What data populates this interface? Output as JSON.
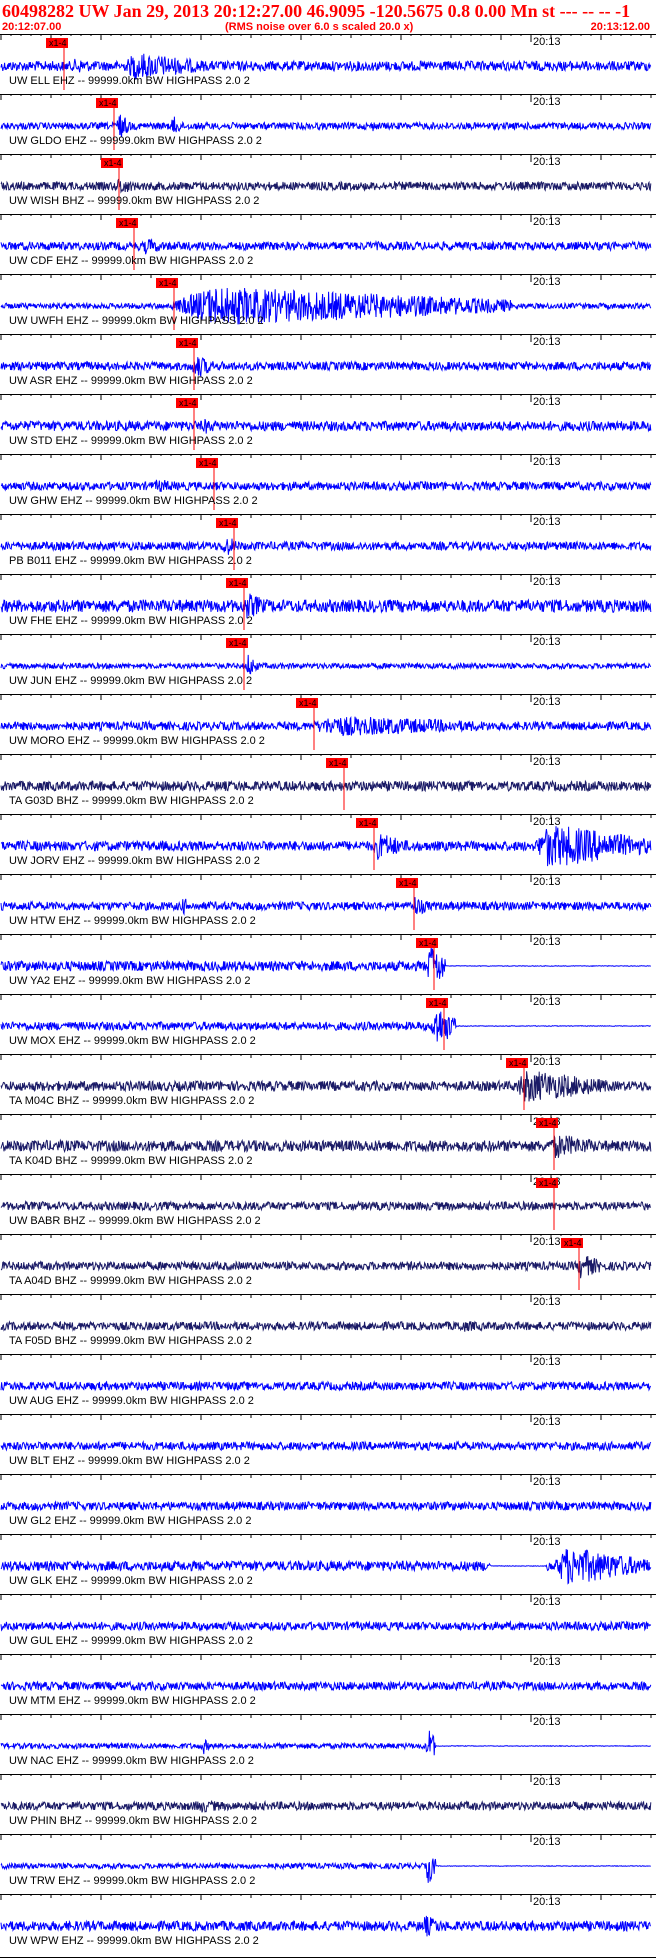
{
  "header": {
    "title": "60498282 UW Jan 29, 2013 20:12:27.00   46.9095 -120.5675  0.8 0.00 Mn st --- -- --   -1",
    "start_time": "20:12:07.00",
    "note": "(RMS noise over 6.0 s scaled 20.0 x)",
    "end_time": "20:13:12.00"
  },
  "colors": {
    "header_text": "#ff0000",
    "trace_blue": "#0000ff",
    "trace_navy": "#1a1a66",
    "pick": "#ff0000",
    "axis": "#000000"
  },
  "chart_data": {
    "type": "line",
    "title": "60498282 UW Jan 29, 2013 20:12:27.00   46.9095 -120.5675  0.8 0.00 Mn st --- -- --   -1",
    "subtitle": "(RMS noise over 6.0 s scaled 20.0 x)",
    "x_start": "20:12:07.00",
    "x_end": "20:13:12.00",
    "minute_label": "20:13",
    "minute_mark_s": 53,
    "xlim_s": [
      0,
      65
    ],
    "traces": [
      {
        "label": "UW ELL EHZ -- 99999.0km BW  HIGHPASS  2.0  2",
        "color": "#0000ff",
        "pick_label": "x1-4",
        "pick_s": 4.5,
        "amp": 0.35,
        "events": [
          {
            "t": 12,
            "dur": 9,
            "amp": 1.0
          },
          {
            "t": 7,
            "dur": 3,
            "amp": 0.6
          }
        ]
      },
      {
        "label": "UW GLDO EHZ -- 99999.0km BW  HIGHPASS  2.0  2",
        "color": "#0000ff",
        "pick_label": "x1-4",
        "pick_s": 9.5,
        "amp": 0.25,
        "events": [
          {
            "t": 11.5,
            "dur": 1.5,
            "amp": 1.0
          },
          {
            "t": 17,
            "dur": 1.2,
            "amp": 0.8
          },
          {
            "t": 37,
            "dur": 1,
            "amp": 0.4
          },
          {
            "t": 53,
            "dur": 1,
            "amp": 0.5
          }
        ]
      },
      {
        "label": "UW WISH BHZ -- 99999.0km BW  HIGHPASS  2.0  2",
        "color": "#1a1a66",
        "pick_label": "x1-4",
        "pick_s": 10,
        "amp": 0.3,
        "events": [
          {
            "t": 11.5,
            "dur": 2,
            "amp": 0.7
          }
        ]
      },
      {
        "label": "UW CDF EHZ -- 99999.0km BW  HIGHPASS  2.0  2",
        "color": "#0000ff",
        "pick_label": "x1-4",
        "pick_s": 11.5,
        "amp": 0.3,
        "events": [
          {
            "t": 14,
            "dur": 3,
            "amp": 0.6
          }
        ]
      },
      {
        "label": "UW UWFH EHZ -- 99999.0km BW  HIGHPASS  2.0  2",
        "color": "#0000ff",
        "pick_label": "x1-4",
        "pick_s": 15.5,
        "amp": 0.2,
        "events": [
          {
            "t": 16,
            "dur": 35,
            "amp": 1.4
          }
        ]
      },
      {
        "label": "UW ASR EHZ -- 99999.0km BW  HIGHPASS  2.0  2",
        "color": "#0000ff",
        "pick_label": "x1-4",
        "pick_s": 17.5,
        "amp": 0.3,
        "events": [
          {
            "t": 19,
            "dur": 2.5,
            "amp": 0.9
          }
        ]
      },
      {
        "label": "UW STD EHZ -- 99999.0km BW  HIGHPASS  2.0  2",
        "color": "#0000ff",
        "pick_label": "x1-4",
        "pick_s": 17.5,
        "amp": 0.35,
        "events": [
          {
            "t": 20,
            "dur": 2,
            "amp": 0.6
          }
        ]
      },
      {
        "label": "UW GHW EHZ -- 99999.0km BW  HIGHPASS  2.0  2",
        "color": "#0000ff",
        "pick_label": "x1-4",
        "pick_s": 19.5,
        "amp": 0.3,
        "events": [
          {
            "t": 15,
            "dur": 4,
            "amp": 0.5
          },
          {
            "t": 28,
            "dur": 3,
            "amp": 0.4
          }
        ]
      },
      {
        "label": "PB B011 EHZ -- 99999.0km BW  HIGHPASS  2.0  2",
        "color": "#0000ff",
        "pick_label": "x1-4",
        "pick_s": 21.5,
        "amp": 0.3,
        "events": [
          {
            "t": 22,
            "dur": 2,
            "amp": 0.8
          }
        ]
      },
      {
        "label": "UW FHE EHZ -- 99999.0km BW  HIGHPASS  2.0  2",
        "color": "#0000ff",
        "pick_label": "x1-4",
        "pick_s": 22.5,
        "amp": 0.45,
        "events": [
          {
            "t": 24,
            "dur": 3,
            "amp": 1.0
          }
        ]
      },
      {
        "label": "UW JUN EHZ -- 99999.0km BW  HIGHPASS  2.0  2",
        "color": "#0000ff",
        "pick_label": "x1-4",
        "pick_s": 22.5,
        "amp": 0.2,
        "events": [
          {
            "t": 24.5,
            "dur": 1.2,
            "amp": 0.9
          }
        ]
      },
      {
        "label": "UW MORO EHZ -- 99999.0km BW  HIGHPASS  2.0  2",
        "color": "#0000ff",
        "pick_label": "x1-4",
        "pick_s": 29.5,
        "amp": 0.3,
        "events": [
          {
            "t": 30,
            "dur": 22,
            "amp": 0.75
          }
        ]
      },
      {
        "label": "TA G03D BHZ -- 99999.0km BW  HIGHPASS  2.0  2",
        "color": "#1a1a66",
        "pick_label": "x1-4",
        "pick_s": 32.5,
        "amp": 0.35,
        "events": []
      },
      {
        "label": "UW JORV EHZ -- 99999.0km BW  HIGHPASS  2.0  2",
        "color": "#0000ff",
        "pick_label": "x1-4",
        "pick_s": 35.5,
        "amp": 0.35,
        "events": [
          {
            "t": 37,
            "dur": 4,
            "amp": 1.0
          },
          {
            "t": 53,
            "dur": 12,
            "amp": 1.6
          }
        ]
      },
      {
        "label": "UW HTW EHZ -- 99999.0km BW  HIGHPASS  2.0  2",
        "color": "#0000ff",
        "pick_label": "x1-4",
        "pick_s": 39.5,
        "amp": 0.3,
        "events": [
          {
            "t": 18,
            "dur": 1,
            "amp": 0.7
          },
          {
            "t": 41,
            "dur": 2,
            "amp": 0.8
          }
        ]
      },
      {
        "label": "UW YA2 EHZ -- 99999.0km BW  HIGHPASS  2.0  2",
        "color": "#0000ff",
        "pick_label": "x1-4",
        "pick_s": 41.5,
        "amp": 0.35,
        "events": [
          {
            "t": 42.5,
            "dur": 2.5,
            "amp": 1.6
          }
        ],
        "flat_after_s": 44.5
      },
      {
        "label": "UW MOX EHZ -- 99999.0km BW  HIGHPASS  2.0  2",
        "color": "#0000ff",
        "pick_label": "x1-4",
        "pick_s": 42.5,
        "amp": 0.3,
        "events": [
          {
            "t": 43,
            "dur": 2.5,
            "amp": 1.6
          }
        ],
        "flat_after_s": 45.5
      },
      {
        "label": "TA M04C BHZ -- 99999.0km BW  HIGHPASS  2.0  2",
        "color": "#1a1a66",
        "pick_label": "x1-4",
        "pick_s": 50.5,
        "amp": 0.35,
        "events": [
          {
            "t": 51,
            "dur": 10,
            "amp": 1.2
          }
        ]
      },
      {
        "label": "TA K04D BHZ -- 99999.0km BW  HIGHPASS  2.0  2",
        "color": "#1a1a66",
        "pick_label": "x1-4",
        "pick_s": 53.5,
        "amp": 0.4,
        "events": [
          {
            "t": 54.5,
            "dur": 6,
            "amp": 0.9
          }
        ]
      },
      {
        "label": "UW BABR BHZ -- 99999.0km BW  HIGHPASS  2.0  2",
        "color": "#1a1a66",
        "pick_label": "x1-4",
        "pick_s": 53.5,
        "amp": 0.3,
        "events": []
      },
      {
        "label": "TA A04D BHZ -- 99999.0km BW  HIGHPASS  2.0  2",
        "color": "#1a1a66",
        "pick_label": "x1-4",
        "pick_s": 56,
        "amp": 0.3,
        "events": [
          {
            "t": 57.5,
            "dur": 3,
            "amp": 0.9
          }
        ]
      },
      {
        "label": "TA F05D BHZ -- 99999.0km BW  HIGHPASS  2.0  2",
        "color": "#1a1a66",
        "amp": 0.3,
        "events": [
          {
            "t": 45,
            "dur": 5,
            "amp": 0.45
          }
        ]
      },
      {
        "label": "UW AUG EHZ -- 99999.0km BW  HIGHPASS  2.0  2",
        "color": "#0000ff",
        "amp": 0.3,
        "events": []
      },
      {
        "label": "UW BLT EHZ -- 99999.0km BW  HIGHPASS  2.0  2",
        "color": "#0000ff",
        "amp": 0.3,
        "events": []
      },
      {
        "label": "UW GL2 EHZ -- 99999.0km BW  HIGHPASS  2.0  2",
        "color": "#0000ff",
        "amp": 0.3,
        "events": []
      },
      {
        "label": "UW GLK EHZ -- 99999.0km BW  HIGHPASS  2.0  2",
        "color": "#0000ff",
        "amp": 0.35,
        "events": [
          {
            "t": 55,
            "dur": 10,
            "amp": 1.4
          }
        ],
        "flat_between_s": [
          49,
          54.5
        ]
      },
      {
        "label": "UW GUL EHZ -- 99999.0km BW  HIGHPASS  2.0  2",
        "color": "#0000ff",
        "amp": 0.3,
        "events": []
      },
      {
        "label": "UW MTM EHZ -- 99999.0km BW  HIGHPASS  2.0  2",
        "color": "#0000ff",
        "amp": 0.3,
        "events": []
      },
      {
        "label": "UW NAC EHZ -- 99999.0km BW  HIGHPASS  2.0  2",
        "color": "#0000ff",
        "amp": 0.2,
        "events": [
          {
            "t": 20,
            "dur": 0.8,
            "amp": 0.7
          },
          {
            "t": 42.5,
            "dur": 1,
            "amp": 1.5
          }
        ],
        "flat_after_s": 43.5
      },
      {
        "label": "UW PHIN BHZ -- 99999.0km BW  HIGHPASS  2.0  2",
        "color": "#1a1a66",
        "amp": 0.3,
        "events": [
          {
            "t": 19,
            "dur": 5,
            "amp": 0.5
          }
        ]
      },
      {
        "label": "UW TRW EHZ -- 99999.0km BW  HIGHPASS  2.0  2",
        "color": "#0000ff",
        "amp": 0.2,
        "events": [
          {
            "t": 42.5,
            "dur": 1,
            "amp": 1.4
          }
        ],
        "flat_after_s": 43.5
      },
      {
        "label": "UW WPW EHZ -- 99999.0km BW  HIGHPASS  2.0  2",
        "color": "#0000ff",
        "amp": 0.35,
        "events": [
          {
            "t": 42,
            "dur": 2.5,
            "amp": 0.8
          }
        ]
      }
    ]
  }
}
